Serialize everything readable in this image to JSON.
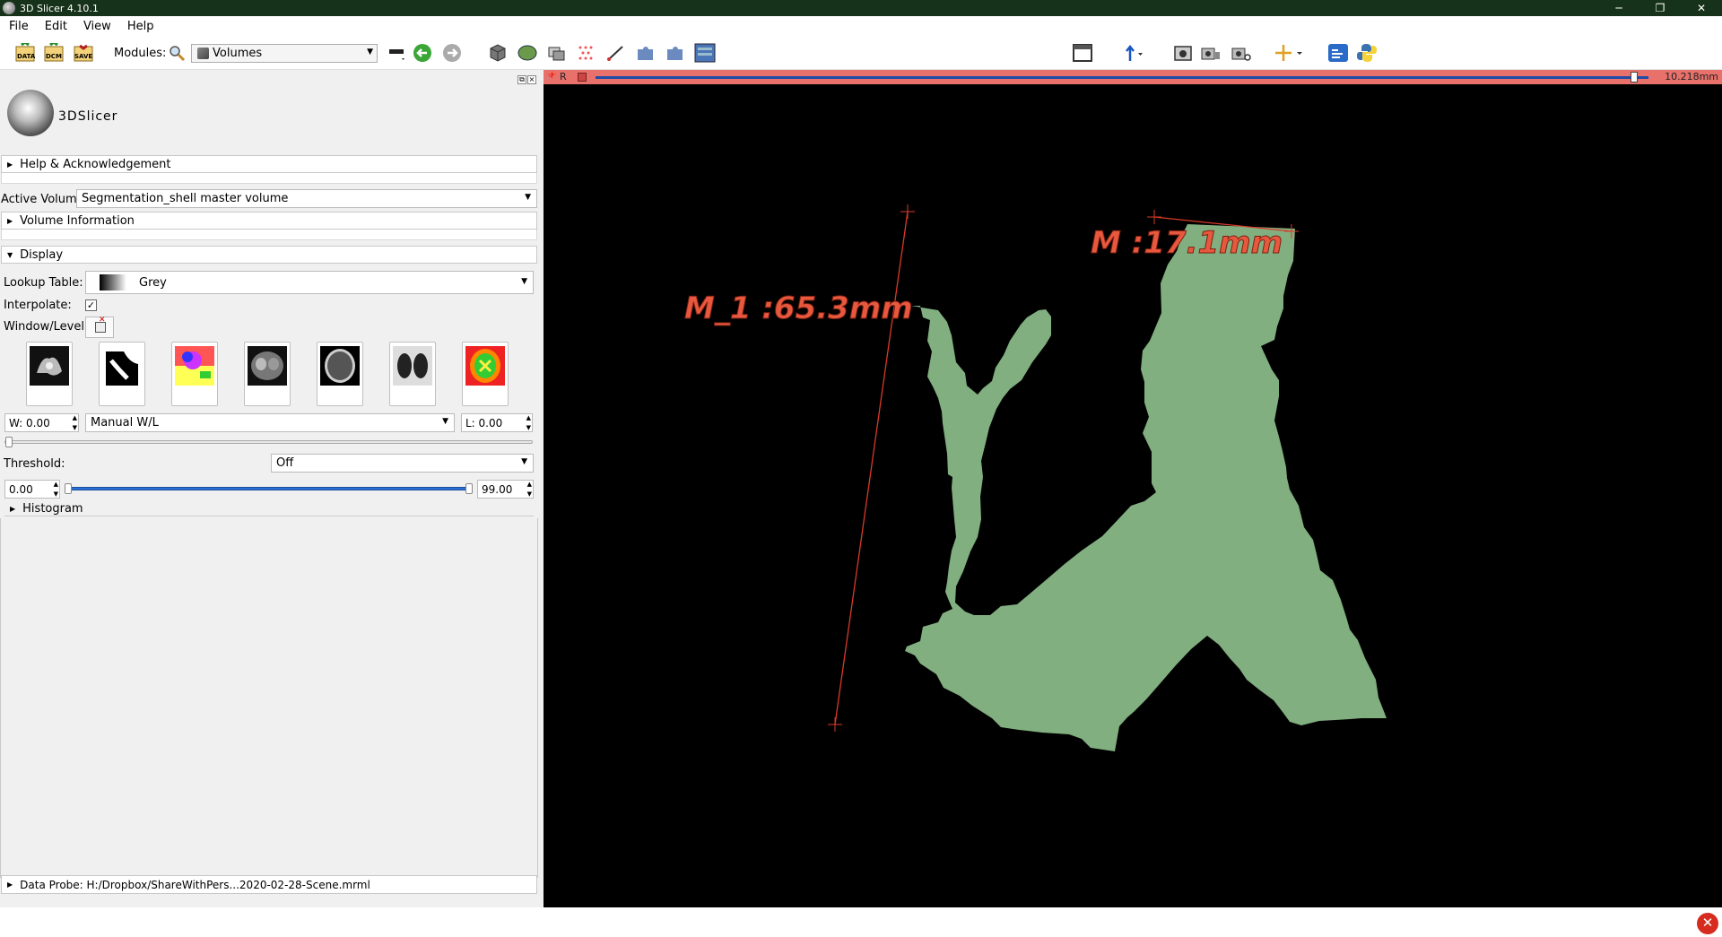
{
  "window": {
    "title": "3D Slicer 4.10.1",
    "minimize": "─",
    "restore": "❐",
    "close": "✕"
  },
  "menu": [
    "File",
    "Edit",
    "View",
    "Help"
  ],
  "toolbar": {
    "modules_label": "Modules:",
    "module_selected": "Volumes",
    "icons": [
      "data-icon",
      "dcm-icon",
      "save-icon",
      "search-icon",
      "history-icon",
      "back-arrow-icon",
      "forward-arrow-icon",
      "volumes-icon",
      "models-icon",
      "transforms-icon",
      "markups-icon",
      "annotations-icon",
      "extension-icon",
      "puzzle-icon",
      "tutorial-icon",
      "layout-icon",
      "axis-icon",
      "screenshot-icon",
      "scene-icon",
      "scene-view-icon",
      "crosshair-icon",
      "extension-manager-icon",
      "python-icon"
    ],
    "data_label": "DATA",
    "dcm_label": "DCM",
    "save_label": "SAVE"
  },
  "left_panel": {
    "logo_text": "3DSlicer",
    "help_section": "Help & Acknowledgement",
    "active_volume_label": "Active Volume",
    "active_volume_value": "Segmentation_shell master volume",
    "volume_info_section": "Volume Information",
    "display_section": "Display",
    "lookup_label": "Lookup Table:",
    "lookup_value": "Grey",
    "interpolate_label": "Interpolate:",
    "interpolate_checked": "✓",
    "window_level_label": "Window/Level:",
    "w_value": "W: 0.00",
    "wl_mode": "Manual W/L",
    "l_value": "L: 0.00",
    "threshold_label": "Threshold:",
    "threshold_value": "Off",
    "threshold_min": "0.00",
    "threshold_max": "99.00",
    "histogram_section": "Histogram",
    "data_probe": "Data Probe: H:/Dropbox/ShareWithPers...2020-02-28-Scene.mrml"
  },
  "slice_view": {
    "orientation": "R",
    "offset": "10.218mm",
    "measurement_1": "M_1 :65.3mm",
    "measurement_2": "M :17.1mm",
    "segment_color": "#81af80",
    "ruler_color": "#d93a2a"
  }
}
